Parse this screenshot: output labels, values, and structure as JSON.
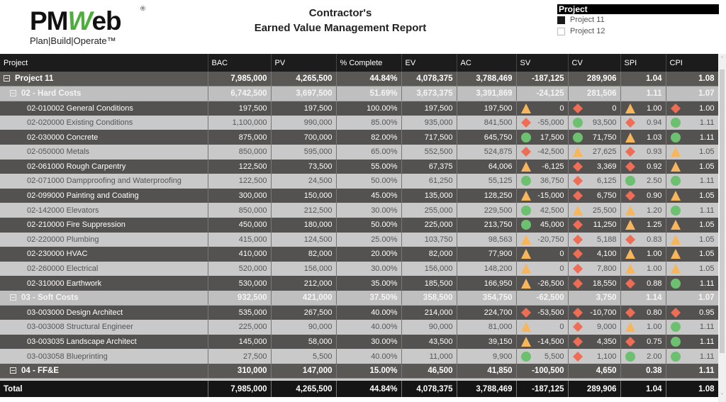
{
  "header": {
    "logo_text_pm": "PM",
    "logo_text_w": "W",
    "logo_text_eb": "eb",
    "logo_reg": "®",
    "logo_tagline": "Plan|Build|Operate™",
    "title_line1": "Contractor's",
    "title_line2": "Earned Value Management Report"
  },
  "slicer": {
    "title": "Project",
    "options": [
      {
        "label": "Project 11",
        "checked": true
      },
      {
        "label": "Project 12",
        "checked": false
      }
    ]
  },
  "colors": {
    "green": "#6cc070",
    "amber": "#f7b55c",
    "red": "#ef6c55",
    "header_bg": "#1c1c1c"
  },
  "table": {
    "columns": [
      "Project",
      "BAC",
      "PV",
      "% Complete",
      "EV",
      "AC",
      "SV",
      "CV",
      "SPI",
      "CPI"
    ],
    "rows": [
      {
        "level": 0,
        "style": "lvl0",
        "name": "Project 11",
        "bac": "7,985,000",
        "pv": "4,265,500",
        "pct": "44.84%",
        "ev": "4,078,375",
        "ac": "3,788,469",
        "sv": "-187,125",
        "cv": "289,906",
        "spi": "1.04",
        "cpi": "1.08"
      },
      {
        "level": 1,
        "style": "lvl1",
        "name": "02 - Hard Costs",
        "bac": "6,742,500",
        "pv": "3,697,500",
        "pct": "51.69%",
        "ev": "3,673,375",
        "ac": "3,391,869",
        "sv": "-24,125",
        "cv": "281,506",
        "spi": "1.11",
        "cpi": "1.07"
      },
      {
        "level": 2,
        "style": "dark",
        "name": "02-010002 General Conditions",
        "bac": "197,500",
        "pv": "197,500",
        "pct": "100.00%",
        "ev": "197,500",
        "ac": "197,500",
        "sv": "0",
        "sv_i": "triangle",
        "cv": "0",
        "cv_i": "diamond",
        "spi": "1.00",
        "spi_i": "triangle",
        "cpi": "1.00",
        "cpi_i": "diamond"
      },
      {
        "level": 2,
        "style": "light",
        "name": "02-020000 Existing Conditions",
        "bac": "1,100,000",
        "pv": "990,000",
        "pct": "85.00%",
        "ev": "935,000",
        "ac": "841,500",
        "sv": "-55,000",
        "sv_i": "diamond",
        "cv": "93,500",
        "cv_i": "circle",
        "spi": "0.94",
        "spi_i": "diamond",
        "cpi": "1.11",
        "cpi_i": "circle"
      },
      {
        "level": 2,
        "style": "dark",
        "name": "02-030000 Concrete",
        "bac": "875,000",
        "pv": "700,000",
        "pct": "82.00%",
        "ev": "717,500",
        "ac": "645,750",
        "sv": "17,500",
        "sv_i": "circle",
        "cv": "71,750",
        "cv_i": "circle",
        "spi": "1.03",
        "spi_i": "triangle",
        "cpi": "1.11",
        "cpi_i": "circle"
      },
      {
        "level": 2,
        "style": "light",
        "name": "02-050000 Metals",
        "bac": "850,000",
        "pv": "595,000",
        "pct": "65.00%",
        "ev": "552,500",
        "ac": "524,875",
        "sv": "-42,500",
        "sv_i": "diamond",
        "cv": "27,625",
        "cv_i": "triangle",
        "spi": "0.93",
        "spi_i": "diamond",
        "cpi": "1.05",
        "cpi_i": "triangle"
      },
      {
        "level": 2,
        "style": "dark",
        "name": "02-061000 Rough Carpentry",
        "bac": "122,500",
        "pv": "73,500",
        "pct": "55.00%",
        "ev": "67,375",
        "ac": "64,006",
        "sv": "-6,125",
        "sv_i": "triangle",
        "cv": "3,369",
        "cv_i": "diamond",
        "spi": "0.92",
        "spi_i": "diamond",
        "cpi": "1.05",
        "cpi_i": "triangle"
      },
      {
        "level": 2,
        "style": "light",
        "name": "02-071000 Dampproofing and Waterproofing",
        "bac": "122,500",
        "pv": "24,500",
        "pct": "50.00%",
        "ev": "61,250",
        "ac": "55,125",
        "sv": "36,750",
        "sv_i": "circle",
        "cv": "6,125",
        "cv_i": "diamond",
        "spi": "2.50",
        "spi_i": "circle",
        "cpi": "1.11",
        "cpi_i": "circle"
      },
      {
        "level": 2,
        "style": "dark",
        "name": "02-099000 Painting and Coating",
        "bac": "300,000",
        "pv": "150,000",
        "pct": "45.00%",
        "ev": "135,000",
        "ac": "128,250",
        "sv": "-15,000",
        "sv_i": "triangle",
        "cv": "6,750",
        "cv_i": "diamond",
        "spi": "0.90",
        "spi_i": "diamond",
        "cpi": "1.05",
        "cpi_i": "triangle"
      },
      {
        "level": 2,
        "style": "light",
        "name": "02-142000 Elevators",
        "bac": "850,000",
        "pv": "212,500",
        "pct": "30.00%",
        "ev": "255,000",
        "ac": "229,500",
        "sv": "42,500",
        "sv_i": "circle",
        "cv": "25,500",
        "cv_i": "triangle",
        "spi": "1.20",
        "spi_i": "triangle",
        "cpi": "1.11",
        "cpi_i": "circle"
      },
      {
        "level": 2,
        "style": "dark",
        "name": "02-210000 Fire Suppression",
        "bac": "450,000",
        "pv": "180,000",
        "pct": "50.00%",
        "ev": "225,000",
        "ac": "213,750",
        "sv": "45,000",
        "sv_i": "circle",
        "cv": "11,250",
        "cv_i": "diamond",
        "spi": "1.25",
        "spi_i": "triangle",
        "cpi": "1.05",
        "cpi_i": "triangle"
      },
      {
        "level": 2,
        "style": "light",
        "name": "02-220000 Plumbing",
        "bac": "415,000",
        "pv": "124,500",
        "pct": "25.00%",
        "ev": "103,750",
        "ac": "98,563",
        "sv": "-20,750",
        "sv_i": "triangle",
        "cv": "5,188",
        "cv_i": "diamond",
        "spi": "0.83",
        "spi_i": "diamond",
        "cpi": "1.05",
        "cpi_i": "triangle"
      },
      {
        "level": 2,
        "style": "dark",
        "name": "02-230000 HVAC",
        "bac": "410,000",
        "pv": "82,000",
        "pct": "20.00%",
        "ev": "82,000",
        "ac": "77,900",
        "sv": "0",
        "sv_i": "triangle",
        "cv": "4,100",
        "cv_i": "diamond",
        "spi": "1.00",
        "spi_i": "triangle",
        "cpi": "1.05",
        "cpi_i": "triangle"
      },
      {
        "level": 2,
        "style": "light",
        "name": "02-260000 Electrical",
        "bac": "520,000",
        "pv": "156,000",
        "pct": "30.00%",
        "ev": "156,000",
        "ac": "148,200",
        "sv": "0",
        "sv_i": "triangle",
        "cv": "7,800",
        "cv_i": "diamond",
        "spi": "1.00",
        "spi_i": "triangle",
        "cpi": "1.05",
        "cpi_i": "triangle"
      },
      {
        "level": 2,
        "style": "dark",
        "name": "02-310000 Earthwork",
        "bac": "530,000",
        "pv": "212,000",
        "pct": "35.00%",
        "ev": "185,500",
        "ac": "166,950",
        "sv": "-26,500",
        "sv_i": "triangle",
        "cv": "18,550",
        "cv_i": "diamond",
        "spi": "0.88",
        "spi_i": "diamond",
        "cpi": "1.11",
        "cpi_i": "circle"
      },
      {
        "level": 1,
        "style": "lvl1",
        "name": "03 - Soft Costs",
        "bac": "932,500",
        "pv": "421,000",
        "pct": "37.50%",
        "ev": "358,500",
        "ac": "354,750",
        "sv": "-62,500",
        "cv": "3,750",
        "spi": "1.14",
        "cpi": "1.07"
      },
      {
        "level": 2,
        "style": "dark",
        "name": "03-003000 Design Architect",
        "bac": "535,000",
        "pv": "267,500",
        "pct": "40.00%",
        "ev": "214,000",
        "ac": "224,700",
        "sv": "-53,500",
        "sv_i": "diamond",
        "cv": "-10,700",
        "cv_i": "diamond",
        "spi": "0.80",
        "spi_i": "diamond",
        "cpi": "0.95",
        "cpi_i": "diamond"
      },
      {
        "level": 2,
        "style": "light",
        "name": "03-003008 Structural Engineer",
        "bac": "225,000",
        "pv": "90,000",
        "pct": "40.00%",
        "ev": "90,000",
        "ac": "81,000",
        "sv": "0",
        "sv_i": "triangle",
        "cv": "9,000",
        "cv_i": "diamond",
        "spi": "1.00",
        "spi_i": "triangle",
        "cpi": "1.11",
        "cpi_i": "circle"
      },
      {
        "level": 2,
        "style": "dark",
        "name": "03-003035 Landscape Architect",
        "bac": "145,000",
        "pv": "58,000",
        "pct": "30.00%",
        "ev": "43,500",
        "ac": "39,150",
        "sv": "-14,500",
        "sv_i": "triangle",
        "cv": "4,350",
        "cv_i": "diamond",
        "spi": "0.75",
        "spi_i": "diamond",
        "cpi": "1.11",
        "cpi_i": "circle"
      },
      {
        "level": 2,
        "style": "light",
        "name": "03-003058 Blueprinting",
        "bac": "27,500",
        "pv": "5,500",
        "pct": "40.00%",
        "ev": "11,000",
        "ac": "9,900",
        "sv": "5,500",
        "sv_i": "circle",
        "cv": "1,100",
        "cv_i": "diamond",
        "spi": "2.00",
        "spi_i": "circle",
        "cpi": "1.11",
        "cpi_i": "circle"
      },
      {
        "level": 1,
        "style": "lvl0",
        "name": "04 - FF&E",
        "bac": "310,000",
        "pv": "147,000",
        "pct": "15.00%",
        "ev": "46,500",
        "ac": "41,850",
        "sv": "-100,500",
        "cv": "4,650",
        "spi": "0.38",
        "cpi": "1.11"
      }
    ],
    "total": {
      "name": "Total",
      "bac": "7,985,000",
      "pv": "4,265,500",
      "pct": "44.84%",
      "ev": "4,078,375",
      "ac": "3,788,469",
      "sv": "-187,125",
      "cv": "289,906",
      "spi": "1.04",
      "cpi": "1.08"
    }
  },
  "scrollbar": {
    "up_icon": "˄",
    "down_icon": "˅"
  }
}
